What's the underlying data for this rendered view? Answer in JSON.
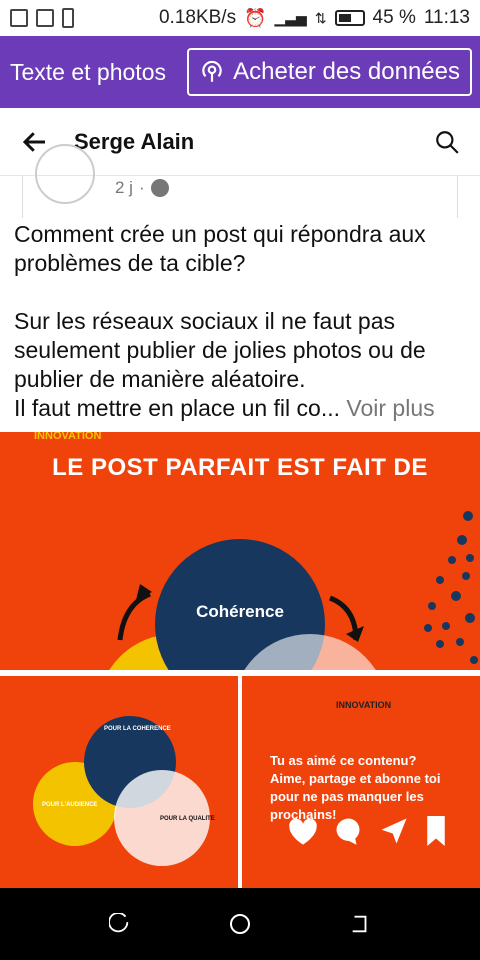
{
  "status_bar": {
    "speed": "0.18KB/s",
    "battery_percent": "45 %",
    "time": "11:13"
  },
  "top_banner": {
    "title": "Texte et photos",
    "buy_button": "Acheter des données"
  },
  "header": {
    "title": "Serge Alain"
  },
  "post": {
    "age": "2 j",
    "separator": "·",
    "paragraph1": "Comment crée un post qui répondra aux problèmes de ta cible?",
    "paragraph2_line1": "Sur les réseaux sociaux il ne faut pas seulement publier de jolies photos ou de publier de manière aléatoire.",
    "paragraph2_line2": "Il faut mettre en place un fil co...",
    "see_more": "Voir plus"
  },
  "image_main": {
    "logo": "INNOVATION",
    "title": "LE POST PARFAIT EST FAIT DE",
    "circle_label": "Cohérence"
  },
  "image_bl": {
    "label_top": "POUR LA COHERENCE",
    "label_left": "POUR L'AUDIENCE",
    "label_right": "POUR LA QUALITE"
  },
  "image_br": {
    "logo": "INNOVATION",
    "line1": "Tu as aimé ce contenu?",
    "line2": "Aime, partage et abonne toi pour ne pas manquer les prochains!"
  },
  "colors": {
    "purple": "#6c3bb8",
    "post_orange": "#f0430c",
    "navy": "#17375e",
    "yellow": "#f4c300"
  }
}
